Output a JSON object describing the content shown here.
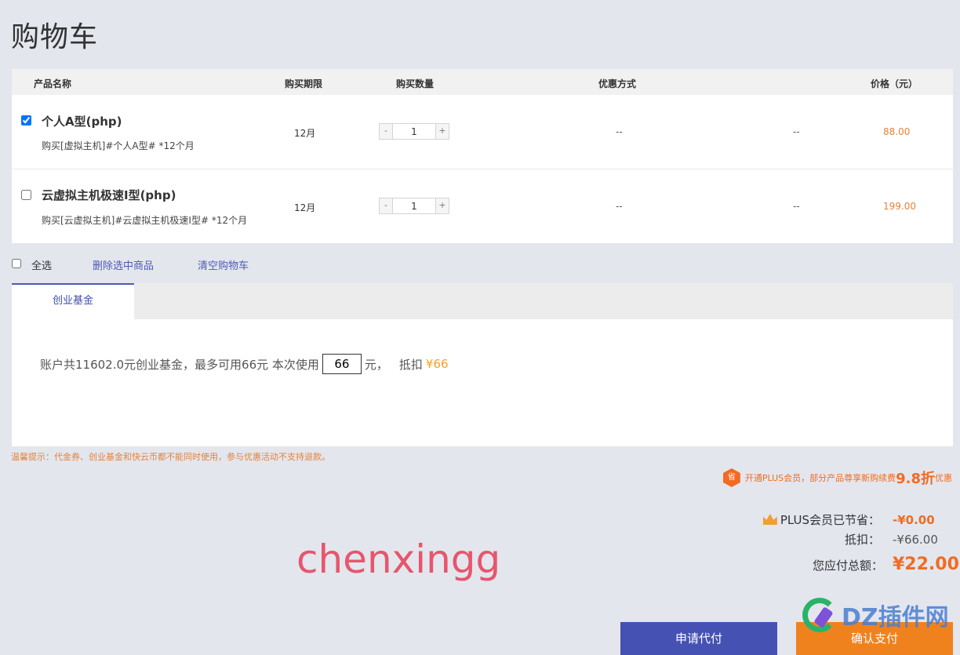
{
  "page": {
    "title": "购物车"
  },
  "table": {
    "headers": {
      "name": "产品名称",
      "period": "购买期限",
      "quantity": "购买数量",
      "discount": "优惠方式",
      "price": "价格（元）"
    },
    "rows": [
      {
        "checked": true,
        "name": "个人A型(php)",
        "desc": "购买[虚拟主机]#个人A型# *12个月",
        "period": "12月",
        "minus": "-",
        "qty": "1",
        "plus": "+",
        "discount": "--",
        "discount2": "--",
        "price": "88.00"
      },
      {
        "checked": false,
        "name": "云虚拟主机极速I型(php)",
        "desc": "购买[云虚拟主机]#云虚拟主机极速I型# *12个月",
        "period": "12月",
        "minus": "-",
        "qty": "1",
        "plus": "+",
        "discount": "--",
        "discount2": "--",
        "price": "199.00"
      }
    ]
  },
  "actions": {
    "select_all": "全选",
    "delete_selected": "删除选中商品",
    "clear_cart": "清空购物车"
  },
  "fund": {
    "tab": "创业基金",
    "text_before": "账户共11602.0元创业基金，最多可用66元   本次使用",
    "use_value": "66",
    "text_unit": "元，",
    "text_deduct_label": "抵扣",
    "deduct_amount": "¥66"
  },
  "tip": "温馨提示：代金券、创业基金和快云币都不能同时使用，参与优惠活动不支持退款。",
  "plus_promo": {
    "badge": "省",
    "text": "开通PLUS会员，部分产品尊享新购续费",
    "big": "9.8折",
    "suffix": "优惠"
  },
  "summary": {
    "plus_saved_label": "PLUS会员已节省：",
    "plus_saved_value": "-¥0.00",
    "deduct_label": "抵扣：",
    "deduct_value": "-¥66.00",
    "total_label": "您应付总额：",
    "total_value": "¥22.00"
  },
  "watermark": "chenxingg",
  "buttons": {
    "apply": "申请代付",
    "pay": "确认支付"
  },
  "logo": {
    "text": "DZ插件网"
  },
  "colors": {
    "accent_blue": "#4552b3",
    "accent_orange": "#f0821e",
    "price_orange": "#e4833b",
    "total_red": "#f06c22"
  }
}
